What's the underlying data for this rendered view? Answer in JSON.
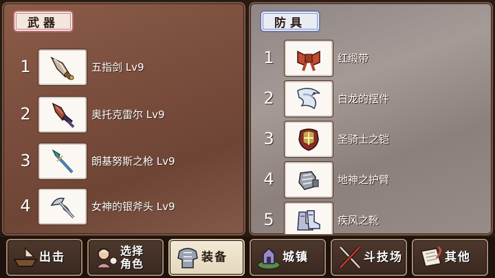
{
  "weapons": {
    "title": "武器",
    "items": [
      {
        "num": "1",
        "name": "五指剑 Lv9",
        "icon": "dagger-icon"
      },
      {
        "num": "2",
        "name": "奥托克雷尔 Lv9",
        "icon": "claw-sword-icon"
      },
      {
        "num": "3",
        "name": "朗基努斯之枪 Lv9",
        "icon": "spear-icon"
      },
      {
        "num": "4",
        "name": "女神的银斧头 Lv9",
        "icon": "silver-axe-icon"
      }
    ]
  },
  "armor": {
    "title": "防具",
    "items": [
      {
        "num": "1",
        "name": "红缎带",
        "icon": "red-ribbon-icon"
      },
      {
        "num": "2",
        "name": "白龙的摆件",
        "icon": "white-dragon-icon"
      },
      {
        "num": "3",
        "name": "圣骑士之铠",
        "icon": "paladin-armor-icon"
      },
      {
        "num": "4",
        "name": "地神之护臂",
        "icon": "gauntlet-icon"
      },
      {
        "num": "5",
        "name": "疾风之靴",
        "icon": "boots-icon"
      }
    ]
  },
  "nav": {
    "sortie": "出击",
    "select_line1": "选择",
    "select_line2": "角色",
    "equipment": "装备",
    "town": "城镇",
    "arena": "斗技场",
    "other": "其他"
  }
}
